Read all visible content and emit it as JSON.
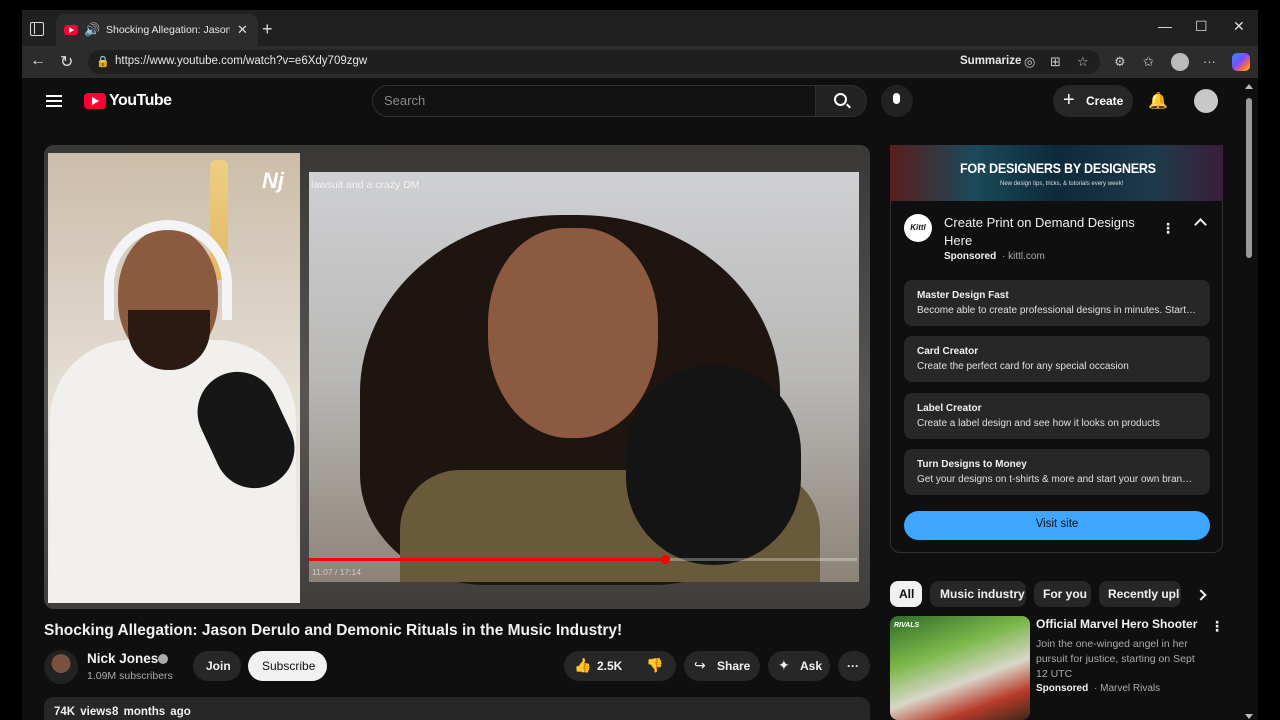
{
  "browser": {
    "tab_title": "Shocking Allegation: Jason D",
    "tab_close": "✕",
    "new_tab": "+",
    "url": "https://www.youtube.com/watch?v=e6Xdy709zgw",
    "summarize": "Summarize",
    "minimize": "—",
    "maximize": "☐",
    "close": "✕",
    "back": "←",
    "reload": "↻",
    "more": "···"
  },
  "yt": {
    "logo": "YouTube",
    "search_placeholder": "Search",
    "create": "Create"
  },
  "video": {
    "overlay_logo": "Nj",
    "caption": "lawsuit and a crazy DM",
    "progress_fraction": 0.65,
    "timecode": "11:07 / 17:14",
    "title": "Shocking Allegation: Jason Derulo and Demonic Rituals in the Music Industry!",
    "channel": "Nick Jones",
    "subscribers": "1.09M subscribers",
    "join": "Join",
    "subscribe": "Subscribe",
    "likes": "2.5K",
    "share": "Share",
    "ask": "Ask",
    "views": "74K views",
    "age": "8 months ago"
  },
  "ad": {
    "banner_title": "FOR DESIGNERS BY DESIGNERS",
    "banner_sub": "New design tips, tricks, & tutorials every week!",
    "logo": "Kittl",
    "title": "Create Print on Demand Designs Here",
    "sponsored": "Sponsored",
    "domain": "· kittl.com",
    "items": [
      {
        "title": "Master Design Fast",
        "desc": "Become able to create professional designs in minutes. Start ..."
      },
      {
        "title": "Card Creator",
        "desc": "Create the perfect card for any special occasion"
      },
      {
        "title": "Label Creator",
        "desc": "Create a label design and see how it looks on products"
      },
      {
        "title": "Turn Designs to Money",
        "desc": "Get your designs on t-shirts & more and start your own brand ..."
      }
    ],
    "visit": "Visit site"
  },
  "chips": [
    "All",
    "Music industry",
    "For you",
    "Recently uplo"
  ],
  "recommended": {
    "thumb_tag": "RIVALS",
    "title": "Official Marvel Hero Shooter",
    "desc": "Join the one-winged angel in her pursuit for justice, starting on Sept 12 UTC",
    "sponsored": "Sponsored",
    "brand": "· Marvel Rivals"
  },
  "colors": {
    "accent_blue": "#3ea6ff",
    "youtube_red": "#ff0033",
    "progress_red": "#ff0000"
  }
}
